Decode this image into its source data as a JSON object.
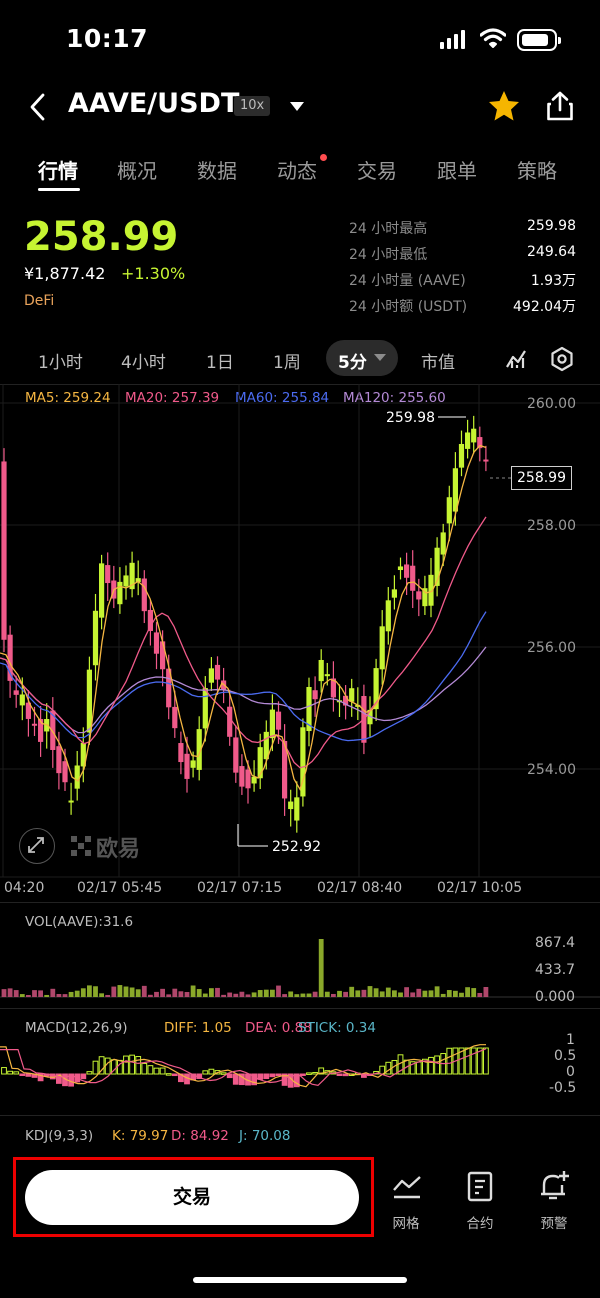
{
  "status": {
    "time": "10:17"
  },
  "header": {
    "pair": "AAVE/USDT",
    "leverage": "10x"
  },
  "tabs": [
    {
      "label": "行情",
      "active": true
    },
    {
      "label": "概况"
    },
    {
      "label": "数据"
    },
    {
      "label": "动态",
      "dot": true
    },
    {
      "label": "交易"
    },
    {
      "label": "跟单"
    },
    {
      "label": "策略"
    }
  ],
  "ticker": {
    "price": "258.99",
    "cny": "¥1,877.42",
    "change": "+1.30%",
    "category": "DeFi",
    "stats": [
      {
        "label": "24 小时最高",
        "value": "259.98"
      },
      {
        "label": "24 小时最低",
        "value": "249.64"
      },
      {
        "label": "24 小时量 (AAVE)",
        "value": "1.93万"
      },
      {
        "label": "24 小时额 (USDT)",
        "value": "492.04万"
      }
    ]
  },
  "intervals": {
    "items": [
      "1小时",
      "4小时",
      "1日",
      "1周"
    ],
    "selected": "5分",
    "extra": "市值"
  },
  "ma": {
    "ma5": "MA5: 259.24",
    "ma20": "MA20: 257.39",
    "ma60": "MA60: 255.84",
    "ma120": "MA120: 255.60",
    "colors": {
      "ma5": "#f5b642",
      "ma20": "#f05a8a",
      "ma60": "#4b6bf0",
      "ma120": "#b48ad6"
    }
  },
  "chart_data": [
    {
      "type": "candlestick",
      "y_ticks": [
        "260.00",
        "258.00",
        "256.00",
        "254.00"
      ],
      "ylim": [
        252.5,
        260.4
      ],
      "x_ticks": [
        "04:20",
        "02/17 05:45",
        "02/17 07:15",
        "02/17 08:40",
        "02/17 10:05"
      ],
      "high_label": "259.98",
      "low_label": "252.92",
      "last_price": "258.99",
      "colors": {
        "up": "#c6f432",
        "down": "#f05a8a"
      }
    },
    {
      "type": "bar",
      "label": "VOL(AAVE):31.6",
      "y_ticks": [
        "867.4",
        "433.7",
        "0.000"
      ]
    },
    {
      "type": "bar",
      "label": "MACD(12,26,9)",
      "diff": "DIFF: 1.05",
      "dea": "DEA: 0.88",
      "stick": "STICK: 0.34",
      "y_ticks": [
        "1",
        "0.5",
        "0",
        "-0.5"
      ]
    },
    {
      "type": "line",
      "label": "KDJ(9,3,3)",
      "k": "K: 79.97",
      "d": "D: 84.92",
      "j": "J: 70.08"
    }
  ],
  "watermark": "欧易",
  "bottom": {
    "trade": "交易",
    "grid": "网格",
    "contract": "合约",
    "alert": "预警"
  }
}
